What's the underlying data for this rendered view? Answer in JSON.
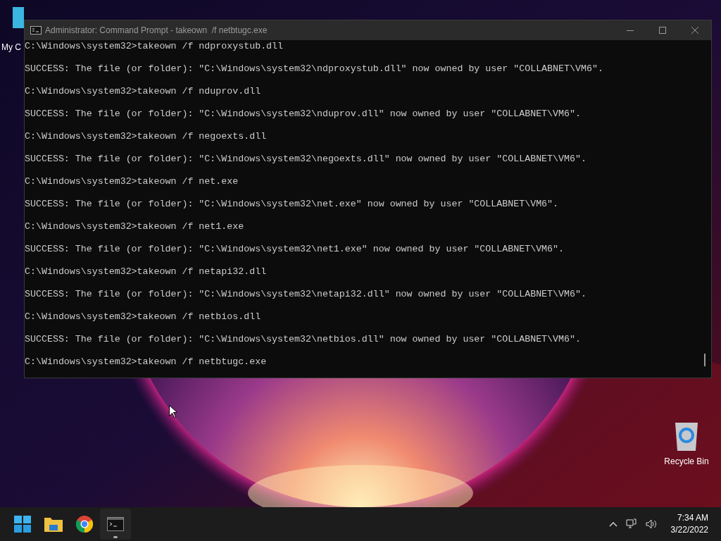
{
  "desktop_icons": [
    {
      "kind": "computer",
      "label": "My C"
    },
    {
      "kind": "recycle",
      "label": "Recycle Bin"
    }
  ],
  "window": {
    "title": "Administrator: Command Prompt - takeown  /f netbtugc.exe",
    "lines": [
      "C:\\Windows\\system32>takeown /f ndproxystub.dll",
      "SUCCESS: The file (or folder): \"C:\\Windows\\system32\\ndproxystub.dll\" now owned by user \"COLLABNET\\VM6\".",
      "C:\\Windows\\system32>takeown /f nduprov.dll",
      "SUCCESS: The file (or folder): \"C:\\Windows\\system32\\nduprov.dll\" now owned by user \"COLLABNET\\VM6\".",
      "C:\\Windows\\system32>takeown /f negoexts.dll",
      "SUCCESS: The file (or folder): \"C:\\Windows\\system32\\negoexts.dll\" now owned by user \"COLLABNET\\VM6\".",
      "C:\\Windows\\system32>takeown /f net.exe",
      "SUCCESS: The file (or folder): \"C:\\Windows\\system32\\net.exe\" now owned by user \"COLLABNET\\VM6\".",
      "C:\\Windows\\system32>takeown /f net1.exe",
      "SUCCESS: The file (or folder): \"C:\\Windows\\system32\\net1.exe\" now owned by user \"COLLABNET\\VM6\".",
      "C:\\Windows\\system32>takeown /f netapi32.dll",
      "SUCCESS: The file (or folder): \"C:\\Windows\\system32\\netapi32.dll\" now owned by user \"COLLABNET\\VM6\".",
      "C:\\Windows\\system32>takeown /f netbios.dll",
      "SUCCESS: The file (or folder): \"C:\\Windows\\system32\\netbios.dll\" now owned by user \"COLLABNET\\VM6\".",
      "C:\\Windows\\system32>takeown /f netbtugc.exe"
    ]
  },
  "taskbar": {
    "apps": [
      {
        "kind": "start",
        "active": false
      },
      {
        "kind": "folder",
        "active": false
      },
      {
        "kind": "browser",
        "active": false
      },
      {
        "kind": "terminal",
        "active": true
      }
    ],
    "time": "7:34 AM",
    "date": "3/22/2022"
  }
}
